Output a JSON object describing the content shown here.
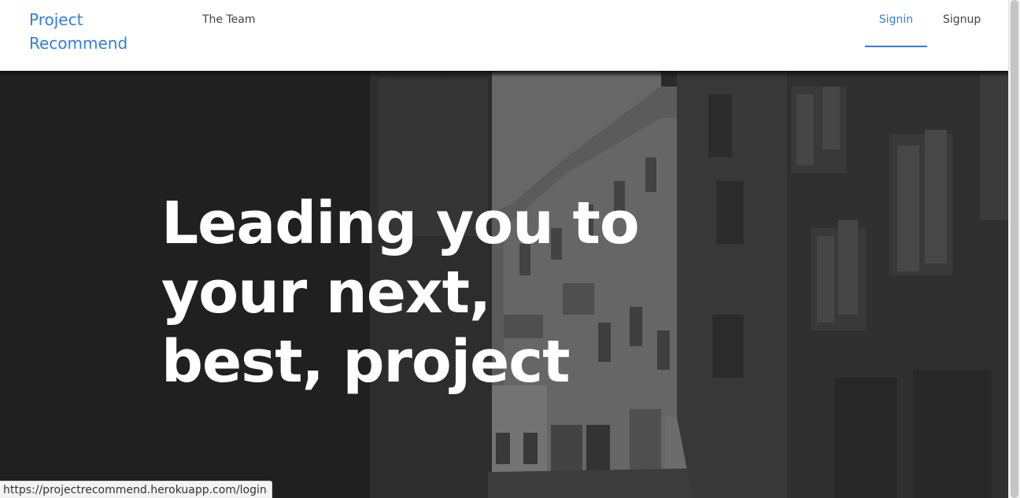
{
  "navbar": {
    "brand": "Project\nRecommend",
    "links": {
      "team": "The Team",
      "signin": "Signin",
      "signup": "Signup"
    },
    "active_link": "Signin"
  },
  "hero": {
    "headline": "Leading you to\nyour next,\nbest, project",
    "background": "grayscale-street-photo"
  },
  "status_bar": {
    "url": "https://projectrecommend.herokuapp.com/login"
  },
  "colors": {
    "accent": "#2f7fe6",
    "nav_text": "#444444",
    "headline": "#ffffff"
  }
}
